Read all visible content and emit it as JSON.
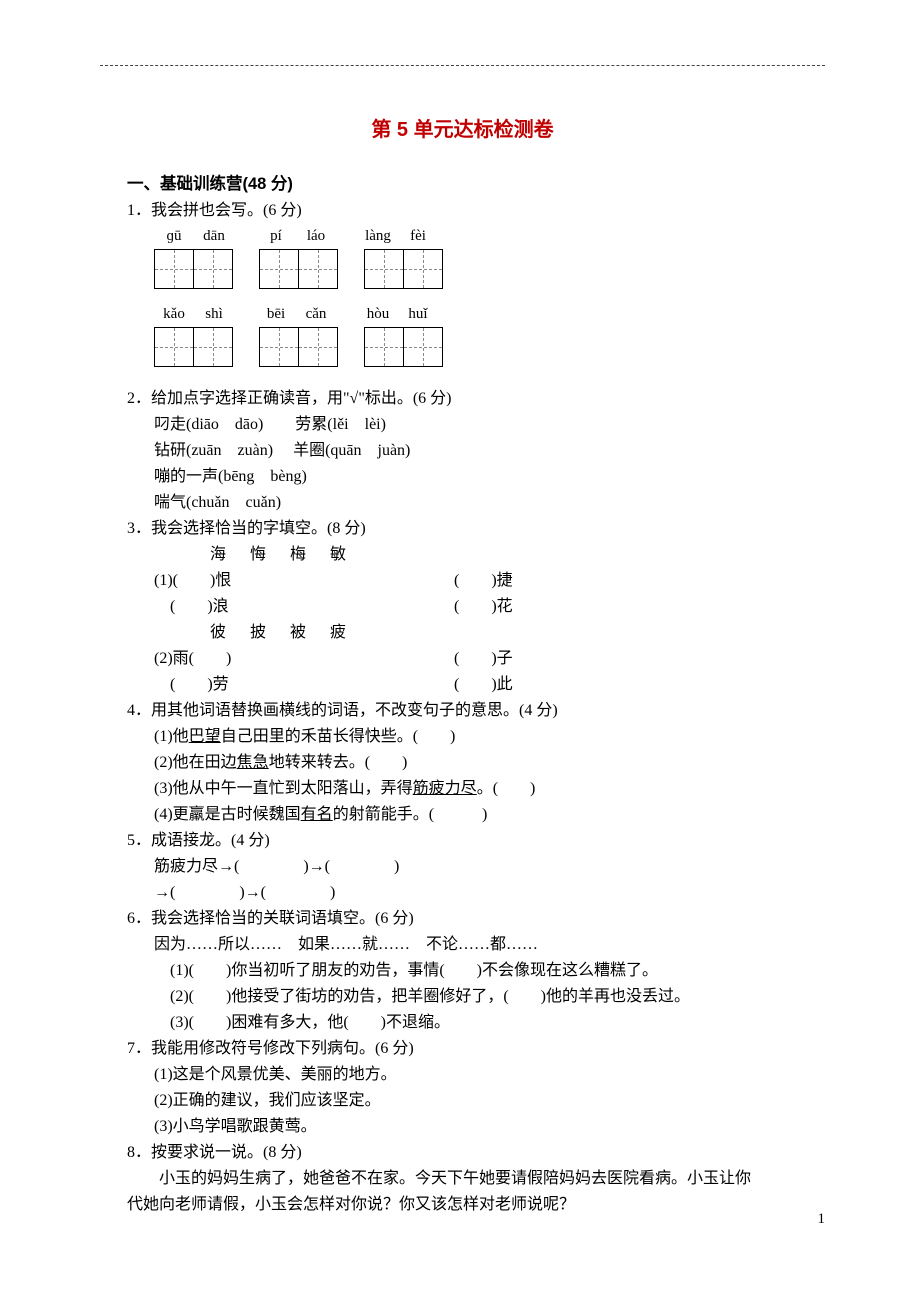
{
  "title": "第 5 单元达标检测卷",
  "section1_head": "一、基础训练营(48 分)",
  "q1": {
    "line": "1．我会拼也会写。(6 分)",
    "row1": {
      "p1a": "ɡū",
      "p1b": "dān",
      "p2a": "pí",
      "p2b": "láo",
      "p3a": "làng",
      "p3b": "fèi"
    },
    "row2": {
      "p1a": "kǎo",
      "p1b": "shì",
      "p2a": "bēi",
      "p2b": "cǎn",
      "p3a": "hòu",
      "p3b": "huǐ"
    }
  },
  "q2": {
    "line": "2．给加点字选择正确读音，用\"√\"标出。(6 分)",
    "items": [
      "叼走(diāo　dāo)　　劳累(lěi　lèi)",
      "钻研(zuān　zuàn)　 羊圈(quān　juàn)",
      "嘣的一声(bēng　bèng)",
      "喘气(chuǎn　cuǎn)"
    ]
  },
  "q3": {
    "line": "3．我会选择恰当的字填空。(8 分)",
    "opts1": "海　悔　梅　敏",
    "pairs1": [
      {
        "l": "(1)(　　)恨",
        "r": "(　　)捷"
      },
      {
        "l": "　(　　)浪",
        "r": "(　　)花"
      }
    ],
    "opts2": "彼　披　被　疲",
    "pairs2": [
      {
        "l": "(2)雨(　　)",
        "r": "(　　)子"
      },
      {
        "l": "　(　　)劳",
        "r": "(　　)此"
      }
    ]
  },
  "q4": {
    "line": "4．用其他词语替换画横线的词语，不改变句子的意思。(4 分)",
    "s1a": "(1)他",
    "s1u": "巴望",
    "s1b": "自己田里的禾苗长得快些。(　　)",
    "s2a": "(2)他在田边",
    "s2u": "焦急",
    "s2b": "地转来转去。(　　)",
    "s3a": "(3)他从中午一直忙到太阳落山，弄得",
    "s3u": "筋疲力尽",
    "s3b": "。(　　)",
    "s4a": "(4)更羸是古时候魏国",
    "s4u": "有名",
    "s4b": "的射箭能手。(　　　)"
  },
  "q5": {
    "line": "5．成语接龙。(4 分)",
    "l1": "筋疲力尽→(　　　　)→(　　　　)",
    "l2": "→(　　　　)→(　　　　)"
  },
  "q6": {
    "line": "6．我会选择恰当的关联词语填空。(6 分)",
    "opts": "因为……所以……　如果……就……　不论……都……",
    "items": [
      "(1)(　　)你当初听了朋友的劝告，事情(　　)不会像现在这么糟糕了。",
      "(2)(　　)他接受了街坊的劝告，把羊圈修好了，(　　)他的羊再也没丢过。",
      "(3)(　　)困难有多大，他(　　)不退缩。"
    ]
  },
  "q7": {
    "line": "7．我能用修改符号修改下列病句。(6 分)",
    "items": [
      "(1)这是个风景优美、美丽的地方。",
      "(2)正确的建议，我们应该坚定。",
      "(3)小鸟学唱歌跟黄莺。"
    ]
  },
  "q8": {
    "line": "8．按要求说一说。(8 分)",
    "p1": "小玉的妈妈生病了，她爸爸不在家。今天下午她要请假陪妈妈去医院看病。小玉让你",
    "p2": "代她向老师请假，小玉会怎样对你说？你又该怎样对老师说呢？"
  },
  "page_num": "1"
}
